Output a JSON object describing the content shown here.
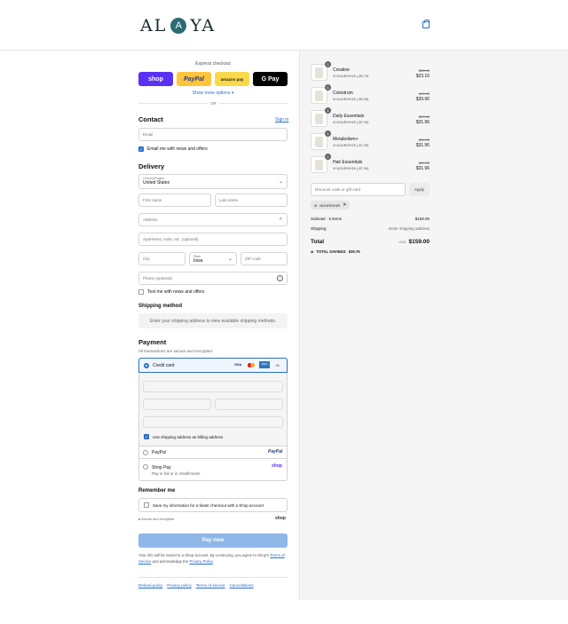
{
  "brand": {
    "logo_left": "AL",
    "logo_mid": "A",
    "logo_right": "YA"
  },
  "express": {
    "title": "Express checkout",
    "buttons": [
      "shop",
      "PayPal",
      "amazon pay",
      "G Pay"
    ],
    "more": "Show more options",
    "or": "OR"
  },
  "contact": {
    "title": "Contact",
    "sign_in": "Sign in",
    "email_placeholder": "Email",
    "email_news": "Email me with news and offers"
  },
  "delivery": {
    "title": "Delivery",
    "country_label": "Country/Region",
    "country_value": "United States",
    "first_name": "First name",
    "last_name": "Last name",
    "address": "Address",
    "apartment": "Apartment, suite, etc. (optional)",
    "city": "City",
    "state_label": "State",
    "state_value": "Iowa",
    "zip": "ZIP code",
    "phone": "Phone (optional)",
    "text_news": "Text me with news and offers"
  },
  "shipping": {
    "title": "Shipping method",
    "note": "Enter your shipping address to view available shipping methods."
  },
  "payment": {
    "title": "Payment",
    "subtitle": "All transactions are secure and encrypted.",
    "credit_card": "Credit card",
    "cards": [
      "VISA",
      "MC",
      "AMEX",
      "+4"
    ],
    "billing_same": "Use shipping address as billing address",
    "paypal": "PayPal",
    "paypal_logo": "PayPal",
    "shoppay": "Shop Pay",
    "shoppay_sub": "Pay in full or in installments",
    "shoppay_logo": "shop"
  },
  "remember": {
    "title": "Remember me",
    "save": "Save my information for a faster checkout with a Shop account",
    "secure": "Secure and encrypted",
    "shop_logo": "shop"
  },
  "pay_now": "Pay now",
  "terms": {
    "line1": "Your info will be saved to a Shop account. By continuing, you agree to Shop's",
    "tos": "Terms of Service",
    "mid": "and acknowledge the",
    "privacy": "Privacy Policy",
    "end": "."
  },
  "footer_links": [
    "Refund policy",
    "Privacy policy",
    "Terms of service",
    "Cancellations"
  ],
  "cart": {
    "items": [
      {
        "name": "Creatine",
        "qty": "1",
        "discount": "NOURISH20 (-$5.79)",
        "old": "$28.95",
        "price": "$23.16"
      },
      {
        "name": "Colostrum",
        "qty": "1",
        "discount": "NOURISH20 (-$9.99)",
        "old": "$49.95",
        "price": "$39.96"
      },
      {
        "name": "Daily Essentials",
        "qty": "1",
        "discount": "NOURISH20 (-$7.99)",
        "old": "$39.95",
        "price": "$31.96"
      },
      {
        "name": "Metabolism+",
        "qty": "1",
        "discount": "NOURISH20 (-$7.99)",
        "old": "$39.95",
        "price": "$31.96"
      },
      {
        "name": "Hair Essentials",
        "qty": "1",
        "discount": "NOURISH20 (-$7.99)",
        "old": "$39.95",
        "price": "$31.96"
      }
    ],
    "discount_placeholder": "Discount code or gift card",
    "apply": "Apply",
    "code_tag": "NOURISH20",
    "subtotal_label": "Subtotal · 5 items",
    "subtotal": "$159.00",
    "shipping_label": "Shipping",
    "shipping_value": "Enter shipping address",
    "total_label": "Total",
    "currency": "USD",
    "total": "$159.00",
    "savings_label": "TOTAL SAVINGS",
    "savings": "$39.75"
  }
}
